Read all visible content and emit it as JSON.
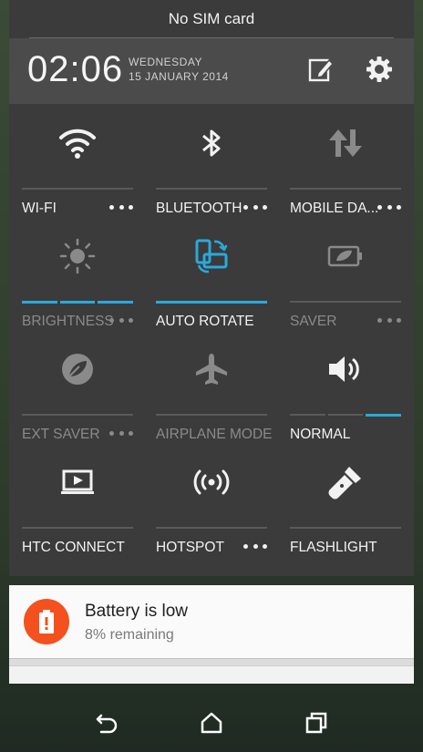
{
  "status": {
    "carrier": "No SIM card"
  },
  "header": {
    "time": "02:06",
    "day": "WEDNESDAY",
    "date": "15 JANUARY 2014"
  },
  "tiles": [
    {
      "label": "WI-FI",
      "icon": "wifi-icon",
      "active": true,
      "more": true
    },
    {
      "label": "BLUETOOTH",
      "icon": "bluetooth-icon",
      "active": true,
      "more": true
    },
    {
      "label": "MOBILE DA...",
      "icon": "mobile-data-icon",
      "active": true,
      "more": true
    },
    {
      "label": "BRIGHTNESS",
      "icon": "brightness-icon",
      "active": false,
      "more": true
    },
    {
      "label": "AUTO ROTATE",
      "icon": "auto-rotate-icon",
      "active": true,
      "more": false
    },
    {
      "label": "SAVER",
      "icon": "battery-saver-icon",
      "active": false,
      "more": true
    },
    {
      "label": "EXT SAVER",
      "icon": "extreme-saver-icon",
      "active": false,
      "more": true
    },
    {
      "label": "AIRPLANE MODE",
      "icon": "airplane-icon",
      "active": false,
      "more": false
    },
    {
      "label": "NORMAL",
      "icon": "volume-icon",
      "active": true,
      "more": false
    },
    {
      "label": "HTC CONNECT",
      "icon": "htc-connect-icon",
      "active": true,
      "more": false
    },
    {
      "label": "HOTSPOT",
      "icon": "hotspot-icon",
      "active": true,
      "more": true
    },
    {
      "label": "FLASHLIGHT",
      "icon": "flashlight-icon",
      "active": true,
      "more": false
    }
  ],
  "notification": {
    "title": "Battery is low",
    "subtitle": "8% remaining",
    "icon": "battery-alert-icon",
    "color": "#f4511e"
  },
  "colors": {
    "accent": "#2aa9dc",
    "panel": "#3b3b3b",
    "header": "#4b4b4b"
  },
  "nav": {
    "back": "back-icon",
    "home": "home-icon",
    "recents": "recents-icon"
  }
}
